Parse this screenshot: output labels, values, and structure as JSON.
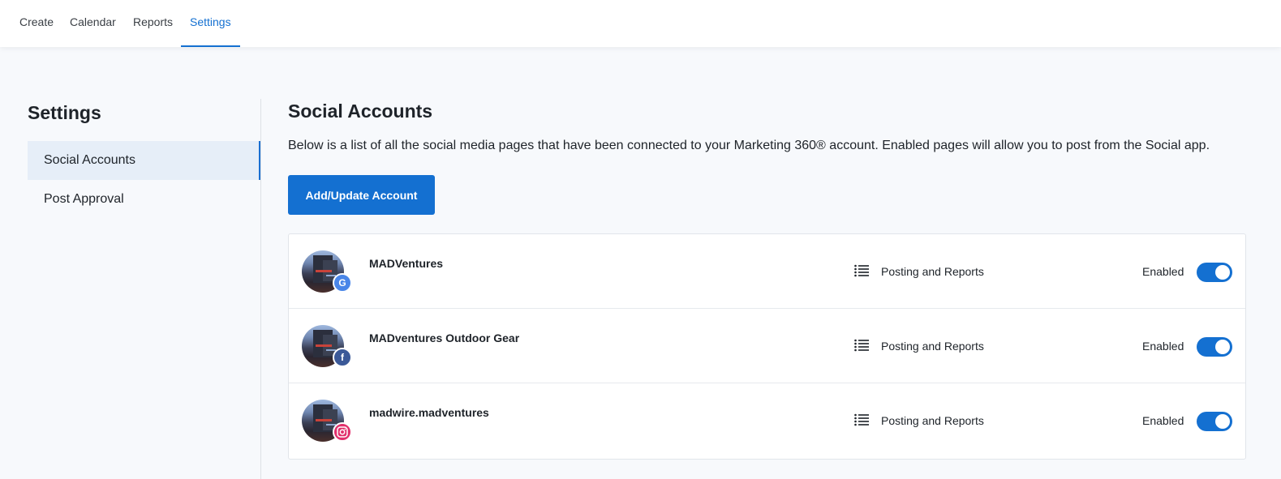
{
  "nav": {
    "tabs": [
      {
        "label": "Create",
        "active": false
      },
      {
        "label": "Calendar",
        "active": false
      },
      {
        "label": "Reports",
        "active": false
      },
      {
        "label": "Settings",
        "active": true
      }
    ]
  },
  "sidebar": {
    "title": "Settings",
    "items": [
      {
        "label": "Social Accounts",
        "active": true
      },
      {
        "label": "Post Approval",
        "active": false
      }
    ]
  },
  "main": {
    "title": "Social Accounts",
    "description": "Below is a list of all the social media pages that have been connected to your Marketing 360® account. Enabled pages will allow you to post from the Social app.",
    "add_button_label": "Add/Update Account",
    "accounts": [
      {
        "name": "MADVentures",
        "network": "google",
        "network_icon": "google-icon",
        "badge_glyph": "G",
        "permission": "Posting and Reports",
        "status": "Enabled",
        "enabled": true
      },
      {
        "name": "MADventures Outdoor Gear",
        "network": "facebook",
        "network_icon": "facebook-icon",
        "badge_glyph": "f",
        "permission": "Posting and Reports",
        "status": "Enabled",
        "enabled": true
      },
      {
        "name": "madwire.madventures",
        "network": "instagram",
        "network_icon": "instagram-icon",
        "badge_glyph": "",
        "permission": "Posting and Reports",
        "status": "Enabled",
        "enabled": true
      }
    ]
  },
  "colors": {
    "accent": "#1470d1",
    "background": "#f7f9fc",
    "google": "#4a86e8",
    "facebook": "#3b5998",
    "instagram": "#e1306c"
  }
}
